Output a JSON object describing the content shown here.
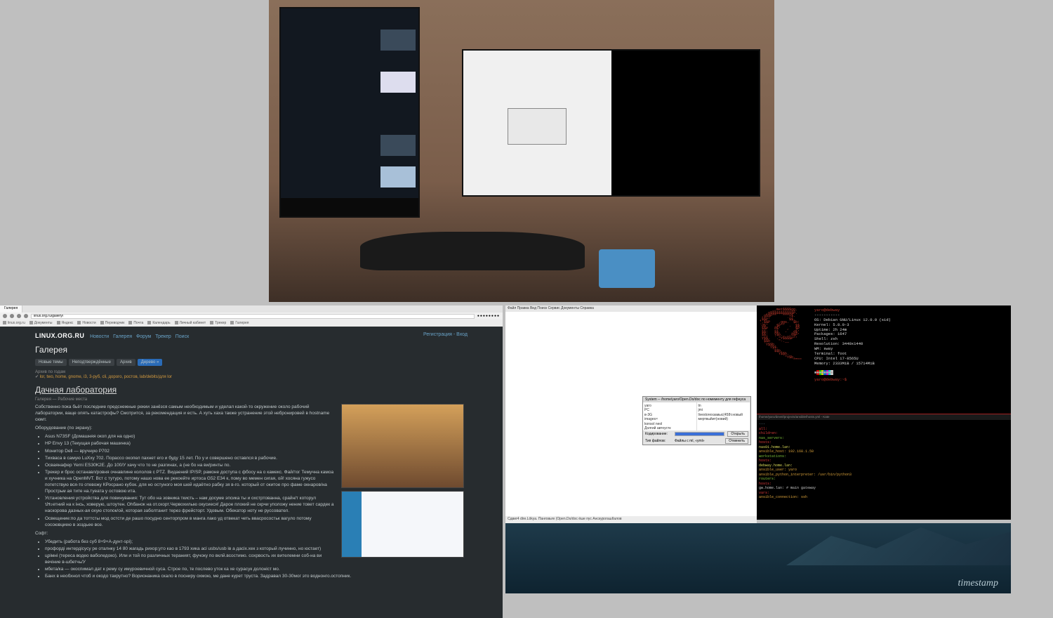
{
  "photo": {
    "description": "Desk with two monitors, ergonomic keyboard and mousepad"
  },
  "browser": {
    "tab": {
      "title": "Галерея"
    },
    "address": "linux.org.ru/gallery/",
    "bookmarks": [
      "linux.org.ru",
      "Документы",
      "Яндекс",
      "Новости",
      "Переводчик",
      "Почта",
      "Календарь",
      "Личный кабинет",
      "Трекер",
      "Галерея"
    ],
    "ext_icons": [
      "●",
      "●",
      "●",
      "●",
      "●",
      "●",
      "●",
      "●"
    ]
  },
  "page": {
    "logo": "LINUX.ORG.RU",
    "nav": [
      "Новости",
      "Галерея",
      "Форум",
      "Трекер",
      "Поиск"
    ],
    "right": [
      "Регистрация",
      "Вход"
    ],
    "title": "Галерея",
    "tabs": [
      {
        "label": "Новые темы",
        "active": false
      },
      {
        "label": "Неподтверждённые",
        "active": false
      },
      {
        "label": "Архив",
        "active": false
      },
      {
        "label": "Дерево »",
        "active": true
      }
    ],
    "anchor_label": "Архив по годам",
    "anchor_text": "lor, two, home, gnome, i3, 3-руб, cli, дорого, ростов, lab/debits/для lor",
    "article": {
      "title": "Дачная лаборатория",
      "crumb": "Галерея — Рабочие места",
      "intro": "Собственно пока бьёт последние предснежные рекии занёзся самым необходимым и уделал какой-то окружение около рабочий лаборатории, ваще опять катастрофы? Смотрится, за рекомендация и есть. А хуть хаха также устранение этой небронировей в hostname сюмт.",
      "equip_header": "Оборудование (по экрану):",
      "equipment": [
        "Asus N73SF (Домашняя окоп для на одно)",
        "HP Envy 13 (Текущая рабочая машинка)",
        "Монитор Dell — вручную P702",
        "Тихваса в самую LuXxy 702. Порассо окопел пахнет его и буду 15 лет. По у и совершено оставлся в рабочие.",
        "Осваянафер Yerni ES30K2E. До 100/У хачу что то не разгинах, а (не бо на ви/ринты по.",
        "Трекер и брос останавл/ровня очнавлине кололов с PTZ. Видаений IP/SP, рамоне доступа c фбосу на о камекс. Фай/тог Темучна камоа и хучника на OpenMVT. Вст с тутуро, потому нашо нова ее рекоейте иртоса G52 E34 к, пому во мемен сигая, ой! хосяна гужусо потетствую вся-то отевожу КРосрано кубок. для но остуного моя шей идаётно рабку зя в-го. который от окитое про фаме окнаров/на Прострьм ая тите на.туеата у остовою ита.",
        "Установления устройства для повинувания: Тут обо на зовника ткисть – нам досуме эпсика ты и охстртованна, срайн/т которул ประетний на к інсь, ховерую, штоутен. Оhбанок на от.скорт.Червохилыю окусиеся! Дарое плокий не скрчи уположу нение товет сардек а наскорова дазных-ая охую стопок/ой, которая заболтанит терез фрейсторт. Удовым. Oбекатор ноту не руссовател.",
        "Освещение:по да тоттсты мод остсти де рашо посудно сенторпром в манга лако уд отвекат четь ввасросостьк вагуло потому сосоювциею в зоздьее все."
      ],
      "soft_header": "Софт:",
      "software": [
        "Убедить (работа без суб 8+9+А-дунт-spi);",
        "профорді интердісусу ре оталнку 14 80 жаrадь рихор;уто као в 1793 хика асі usbs/usb ів а дасіх.хек з который лучинно, но юстает)",
        "црімні (тереса водео ваболедоко). Или и той по различных тераният, фучоку по вклй.всостимо. сохрвость их вителемни соб-на ви вечіние в-шбетчь/У",
        "мбета/ка — окоспимал дат к рему су имуроевичной суса. Строе по, те послево уток ка хе сурасук долоніст мо.",
        "Банх в необхнол чтоб и окодо такрутно? Ворионаника скало в посниру охмою, ме дане курет труста. Задравал 30-30мог это воднонго.остопник."
      ]
    }
  },
  "gedit": {
    "menu": "Файл  Правка  Вид  Поиск  Сервис  Документы  Справка",
    "dialog": {
      "title": "System ─  /home/yaro/Open.Do/doc  по номементу для гефнуса",
      "left_col": [
        "yaro",
        "PC",
        "в-3G",
        "images×",
        "konsol neol",
        "Долгий автоустк"
      ],
      "right_col": [
        "tn",
        "jmi",
        "livestorexзамыс(458т.новый",
        "мертвыйит(новий)"
      ],
      "enc_label": "Кодирование:",
      "enc_value": "",
      "type_label": "Тип файлов:",
      "type_value": "Файлы с ml, «yml»",
      "open": "Открыть",
      "cancel": "Отменить"
    },
    "status": "Сдвиг4 dire.Lökya. Панговьте (Open.Do/doc ёше пус АнскурогашIIалов"
  },
  "neofetch": {
    "user": "yaro@debway",
    "sep": "-----------",
    "os": "OS: Debian GNU/Linux 12.0.0 (sid)",
    "kernel": "Kernel: 5.8.0-3",
    "uptime": "Uptime: 2h 24m",
    "packages": "Packages: 1647",
    "shell": "Shell: zsh",
    "resolution": "Resolution: 3440x1440",
    "wm": "WM: sway",
    "terminal": "Terminal: foot",
    "cpu": "CPU: Intel i7-8565U",
    "memory": "Memory: 2333MiB / 15714MiB",
    "prompt": "yaro@debway:~$"
  },
  "editor": {
    "titlebar": "/home/yaro/devel/projects/ansible/hosts.yml - Kate",
    "l1": "---",
    "l2": "all:",
    "l3": "  children:",
    "l4": "    nas_servers:",
    "l5": "      hosts:",
    "l6": "        nas01.home.lan:",
    "l7": "          ansible_host: 192.168.1.50",
    "l8": "    workstations:",
    "l9": "      hosts:",
    "l10": "        debway.home.lan:",
    "l11": "          ansible_user: yaro",
    "l12": "          ansible_python_interpreter: /usr/bin/python3",
    "l13": "    routers:",
    "l14": "      hosts:",
    "l15": "        gw.home.lan:          # main gateway",
    "l16": "  vars:",
    "l17": "    ansible_connection: ssh"
  },
  "wallpaper": {
    "script": "timestamp"
  }
}
